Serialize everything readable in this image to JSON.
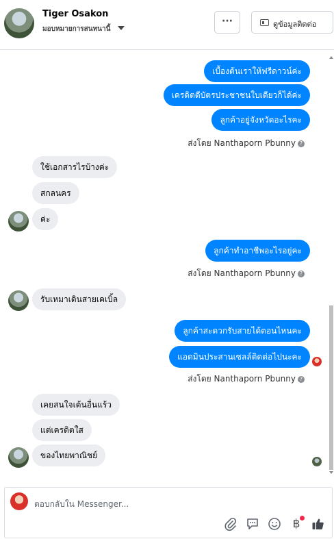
{
  "header": {
    "name": "Tiger Osakon",
    "subtitle": "มอบหมายการสนทนานี้",
    "more_label": "···",
    "contact_label": "ดูข้อมูลติดต่อ"
  },
  "messages": [
    {
      "side": "out",
      "text": "เบื้องต้นเราให้ฟรีดาวน์ค่ะ"
    },
    {
      "side": "out",
      "text": "เครดิตดีบัตรประชาชนใบเดียวก็ได้ค่ะ"
    },
    {
      "side": "out",
      "text": "ลูกค้าอยู่จังหวัดอะไรคะ"
    },
    {
      "side": "out",
      "text": "ลูกค้าทำอาชีพอะไรอยู่คะ"
    },
    {
      "side": "out",
      "text": "ลูกค้าสะดวกรับสายได้ตอนไหนคะ"
    },
    {
      "side": "out",
      "text": "แอดมินประสานเซลล์ติดต่อไปนะคะ"
    },
    {
      "side": "in",
      "text": "ใช้เอกสารไรบ้างค่ะ"
    },
    {
      "side": "in",
      "text": "สกลนคร"
    },
    {
      "side": "in",
      "text": "ค่ะ"
    },
    {
      "side": "in",
      "text": "รับเหมาเดินสายเคเบิ้ล"
    },
    {
      "side": "in",
      "text": "เคยสนใจเต้นอื่นแร้ว"
    },
    {
      "side": "in",
      "text": "แต่เครดิตใส"
    },
    {
      "side": "in",
      "text": "ของไทยพาณิชย์"
    }
  ],
  "sent_by": {
    "prefix": "ส่งโดย",
    "name": "Nanthaporn Pbunny",
    "info": "?"
  },
  "composer": {
    "placeholder": "ตอบกลับใน Messenger...",
    "icons": [
      "attachment-icon",
      "saved-reply-icon",
      "emoji-icon",
      "payment-baht-icon",
      "like-icon"
    ],
    "baht_symbol": "฿"
  }
}
